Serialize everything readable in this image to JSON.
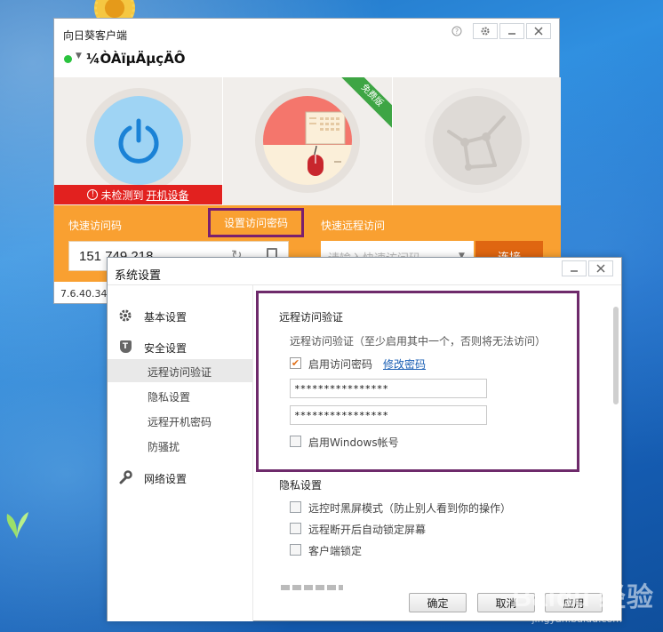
{
  "main_window": {
    "title": "向日葵客户端",
    "machine_name": "¼ÒÀïµÄµçÄÔ",
    "warning_prefix": "未检测到",
    "warning_link": "开机设备",
    "free_badge": "免费版",
    "quick_access_label": "快速访问码",
    "set_password_button": "设置访问密码",
    "quick_remote_label": "快速远程访问",
    "access_code": "151 749 218",
    "remote_input_placeholder": "请输入快速访问码",
    "connect_button": "连接",
    "version": "7.6.40.34",
    "colors": {
      "orange": "#f9a031",
      "warning_red": "#e2211f",
      "status_green": "#2ac33e"
    }
  },
  "settings_dialog": {
    "title": "系统设置",
    "sidebar": {
      "items": [
        {
          "label": "基本设置",
          "icon": "gear-icon"
        },
        {
          "label": "安全设置",
          "icon": "shield-icon"
        },
        {
          "label": "网络设置",
          "icon": "wrench-icon"
        }
      ],
      "sub_items": [
        {
          "label": "远程访问验证",
          "active": true
        },
        {
          "label": "隐私设置",
          "active": false
        },
        {
          "label": "远程开机密码",
          "active": false
        },
        {
          "label": "防骚扰",
          "active": false
        }
      ]
    },
    "remote_auth": {
      "title": "远程访问验证",
      "description": "远程访问验证（至少启用其中一个，否则将无法访问）",
      "enable_password_label": "启用访问密码",
      "enable_password_checked": true,
      "modify_password_link": "修改密码",
      "password_value": "****************",
      "confirm_password_value": "****************",
      "windows_account_label": "启用Windows帐号",
      "windows_account_checked": false
    },
    "privacy": {
      "title": "隐私设置",
      "options": [
        {
          "label": "远控时黑屏模式（防止别人看到你的操作）",
          "checked": false
        },
        {
          "label": "远程断开后自动锁定屏幕",
          "checked": false
        },
        {
          "label": "客户端锁定",
          "checked": false
        }
      ]
    },
    "buttons": {
      "ok": "确定",
      "cancel": "取消",
      "apply": "应用"
    }
  },
  "watermark": {
    "text": "Baidu 经验",
    "sub": "jingyan.baidu.com"
  }
}
